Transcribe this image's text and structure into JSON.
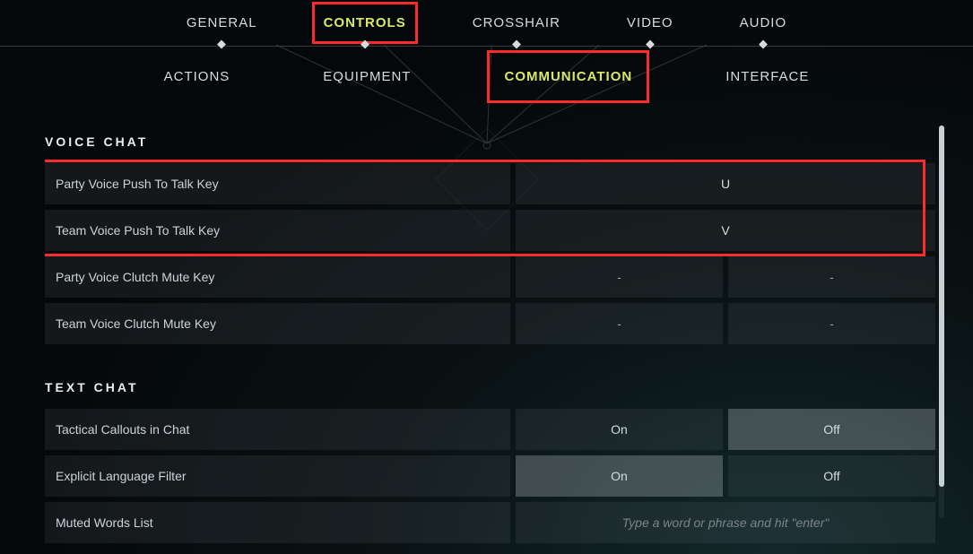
{
  "top_tabs": {
    "general": "GENERAL",
    "controls": "CONTROLS",
    "crosshair": "CROSSHAIR",
    "video": "VIDEO",
    "audio": "AUDIO"
  },
  "sub_tabs": {
    "actions": "ACTIONS",
    "equipment": "EQUIPMENT",
    "communication": "COMMUNICATION",
    "interface": "INTERFACE"
  },
  "sections": {
    "voice_chat": {
      "title": "VOICE CHAT",
      "rows": {
        "party_ptt": {
          "label": "Party Voice Push To Talk Key",
          "value": "U"
        },
        "team_ptt": {
          "label": "Team Voice Push To Talk Key",
          "value": "V"
        },
        "party_clutch": {
          "label": "Party Voice Clutch Mute Key",
          "primary": "-",
          "secondary": "-"
        },
        "team_clutch": {
          "label": "Team Voice Clutch Mute Key",
          "primary": "-",
          "secondary": "-"
        }
      }
    },
    "text_chat": {
      "title": "TEXT CHAT",
      "rows": {
        "tactical_callouts": {
          "label": "Tactical Callouts in Chat",
          "on": "On",
          "off": "Off",
          "selected": "off"
        },
        "explicit_filter": {
          "label": "Explicit Language Filter",
          "on": "On",
          "off": "Off",
          "selected": "on"
        },
        "muted_words": {
          "label": "Muted Words List",
          "placeholder": "Type a word or phrase and hit \"enter\""
        }
      }
    }
  }
}
